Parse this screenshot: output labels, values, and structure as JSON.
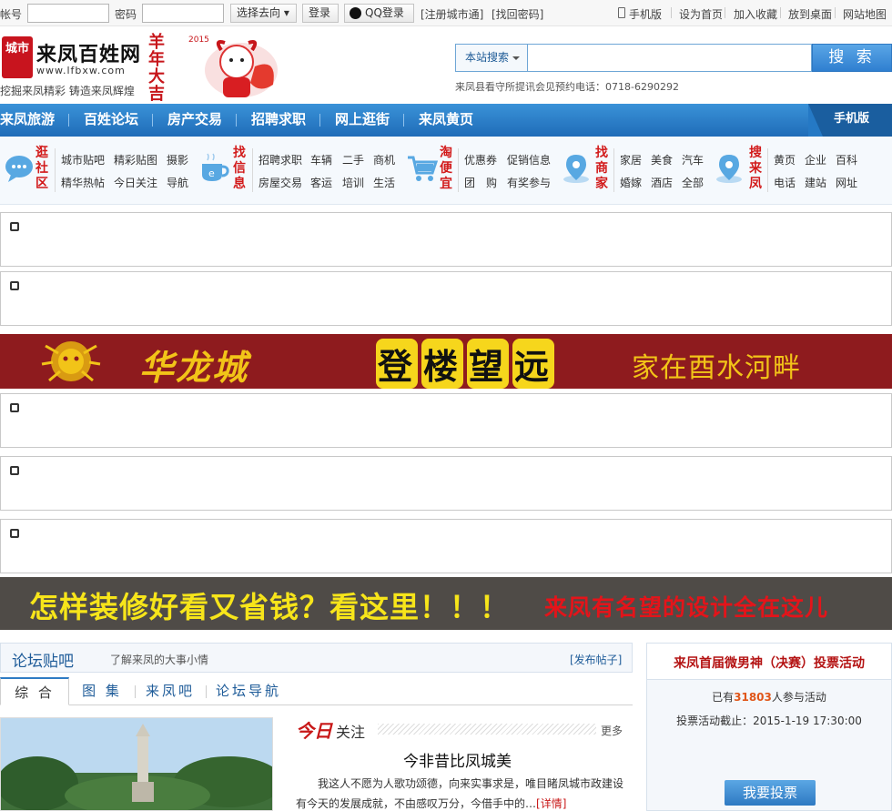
{
  "topbar": {
    "account_label": "帐号",
    "password_label": "密码",
    "select_label": "选择去向 ▾",
    "login_button": "登录",
    "qq_login": "QQ登录",
    "register": "[注册城市通]",
    "find_password": "[找回密码]",
    "links": [
      "手机版",
      "设为首页",
      "加入收藏",
      "放到桌面",
      "网站地图"
    ]
  },
  "header": {
    "site_name": "来凤百姓网",
    "site_url": "www.lfbxw.com",
    "logo_badge": "城市",
    "slogan": "挖掘来凤精彩 铸造来凤辉煌",
    "newyear_text": "羊年大吉",
    "newyear_year": "2015",
    "search_scope": "本站搜索",
    "search_button": "搜 索",
    "search_note": "来凤县看守所提讯会见预约电话：0718-6290292"
  },
  "nav": {
    "items": [
      "来凤旅游",
      "百姓论坛",
      "房产交易",
      "招聘求职",
      "网上逛街",
      "来凤黄页"
    ],
    "mobile": "手机版"
  },
  "categories": [
    {
      "title": "逛社区",
      "icon": "chat-bubble-icon",
      "links": [
        [
          "城市贴吧",
          "精彩贴图",
          "摄影"
        ],
        [
          "精华热帖",
          "今日关注",
          "导航"
        ]
      ]
    },
    {
      "title": "找信息",
      "icon": "cup-icon",
      "links": [
        [
          "招聘求职",
          "车辆",
          "二手",
          "商机"
        ],
        [
          "房屋交易",
          "客运",
          "培训",
          "生活"
        ]
      ]
    },
    {
      "title": "淘便宜",
      "icon": "shopping-cart-icon",
      "links": [
        [
          "优惠券",
          "促销信息"
        ],
        [
          "团　购",
          "有奖参与"
        ]
      ]
    },
    {
      "title": "找商家",
      "icon": "location-pin-icon",
      "links": [
        [
          "家居",
          "美食",
          "汽车"
        ],
        [
          "婚嫁",
          "酒店",
          "全部"
        ]
      ]
    },
    {
      "title": "搜来凤",
      "icon": "location-search-icon",
      "links": [
        [
          "黄页",
          "企业",
          "百科"
        ],
        [
          "电话",
          "建站",
          "网址"
        ]
      ]
    }
  ],
  "banners": {
    "huanglong_title": "华龙城",
    "huanglong_slogan": [
      "登",
      "楼",
      "望",
      "远"
    ],
    "huanglong_tagline": "家在酉水河畔",
    "deco_title": "怎样装修好看又省钱？看这里！！！",
    "deco_tagline": "来凤有名望的设计全在这儿"
  },
  "forum": {
    "title": "论坛贴吧",
    "subtitle": "了解来凤的大事小情",
    "post_link": "[发布帖子]",
    "tabs": [
      "综 合",
      "图 集",
      "来凤吧",
      "论坛导航"
    ],
    "today_red": "今日",
    "today_black": "关注",
    "more": "更多",
    "headline": "今非昔比凤城美",
    "summary": "我这人不愿为人歌功颂德，向来实事求是，唯目睹凤城市政建设有今天的发展成就，不由感叹万分，今借手中的…",
    "detail_link": "[详情]"
  },
  "vote": {
    "title": "来凤首届微男神（决赛）投票活动",
    "count_prefix": "已有",
    "count": "31803",
    "count_suffix": "人参与活动",
    "deadline": "投票活动截止：2015-1-19 17:30:00",
    "button": "我要投票"
  },
  "colors": {
    "nav_blue": "#2a7fcc",
    "accent_red": "#c81818",
    "banner_red": "#8e1b1e"
  }
}
